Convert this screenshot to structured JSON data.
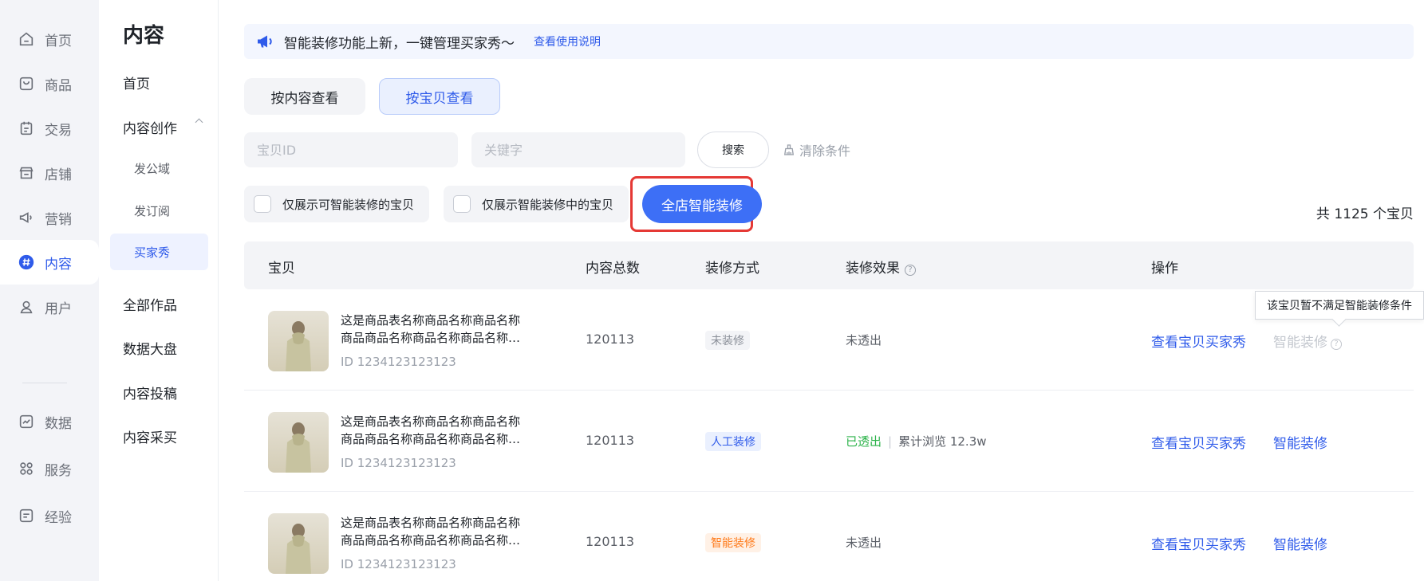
{
  "rail": {
    "items": [
      {
        "label": "首页",
        "icon": "home-icon"
      },
      {
        "label": "商品",
        "icon": "product-icon"
      },
      {
        "label": "交易",
        "icon": "trade-icon"
      },
      {
        "label": "店铺",
        "icon": "store-icon"
      },
      {
        "label": "营销",
        "icon": "megaphone-icon"
      },
      {
        "label": "内容",
        "icon": "hashtag-icon",
        "active": true
      },
      {
        "label": "用户",
        "icon": "user-icon"
      },
      {
        "label": "数据",
        "icon": "chart-icon"
      },
      {
        "label": "服务",
        "icon": "grid-icon"
      },
      {
        "label": "经验",
        "icon": "doc-icon"
      }
    ]
  },
  "submenu": {
    "title": "内容",
    "home": "首页",
    "creation": "内容创作",
    "children": [
      "发公域",
      "发订阅",
      "买家秀"
    ],
    "all_works": "全部作品",
    "dashboard": "数据大盘",
    "submission": "内容投稿",
    "purchase": "内容采买"
  },
  "notice": {
    "text": "智能装修功能上新，一键管理买家秀～",
    "link": "查看使用说明"
  },
  "tabs": {
    "by_content": "按内容查看",
    "by_item": "按宝贝查看"
  },
  "filters": {
    "item_id_placeholder": "宝贝ID",
    "keyword_placeholder": "关键字",
    "search": "搜索",
    "clear": "清除条件",
    "only_can": "仅展示可智能装修的宝贝",
    "only_ing": "仅展示智能装修中的宝贝",
    "all_smart": "全店智能装修",
    "total": "共 1125 个宝贝"
  },
  "table": {
    "headers": {
      "item": "宝贝",
      "total": "内容总数",
      "method": "装修方式",
      "effect": "装修效果",
      "ops": "操作"
    },
    "rows": [
      {
        "name1": "这是商品表名称商品名称商品名称",
        "name2": "商品商品名称商品名称商品名称商品名称",
        "id": "ID 1234123123123",
        "count": "120113",
        "method": "未装修",
        "effect": "未透出",
        "view": "查看宝贝买家秀",
        "smart": "智能装修"
      },
      {
        "name1": "这是商品表名称商品名称商品名称",
        "name2": "商品商品名称商品名称商品名称商品名称",
        "id": "ID 1234123123123",
        "count": "120113",
        "method": "人工装修",
        "effect": "已透出",
        "sep": "|",
        "views": "累计浏览 12.3w",
        "view": "查看宝贝买家秀",
        "smart": "智能装修"
      },
      {
        "name1": "这是商品表名称商品名称商品名称",
        "name2": "商品商品名称商品名称商品名称商品名称",
        "id": "ID 1234123123123",
        "count": "120113",
        "method": "智能装修",
        "effect": "未透出",
        "view": "查看宝贝买家秀",
        "smart": "智能装修"
      }
    ]
  },
  "tooltip": "该宝贝暂不满足智能装修条件",
  "help_glyph": "?",
  "colors": {
    "primary": "#2f5bea",
    "button_blue": "#3d6ff6",
    "highlight": "#e53935",
    "success": "#2cb34a",
    "smart_orange": "#ff7a1a"
  }
}
